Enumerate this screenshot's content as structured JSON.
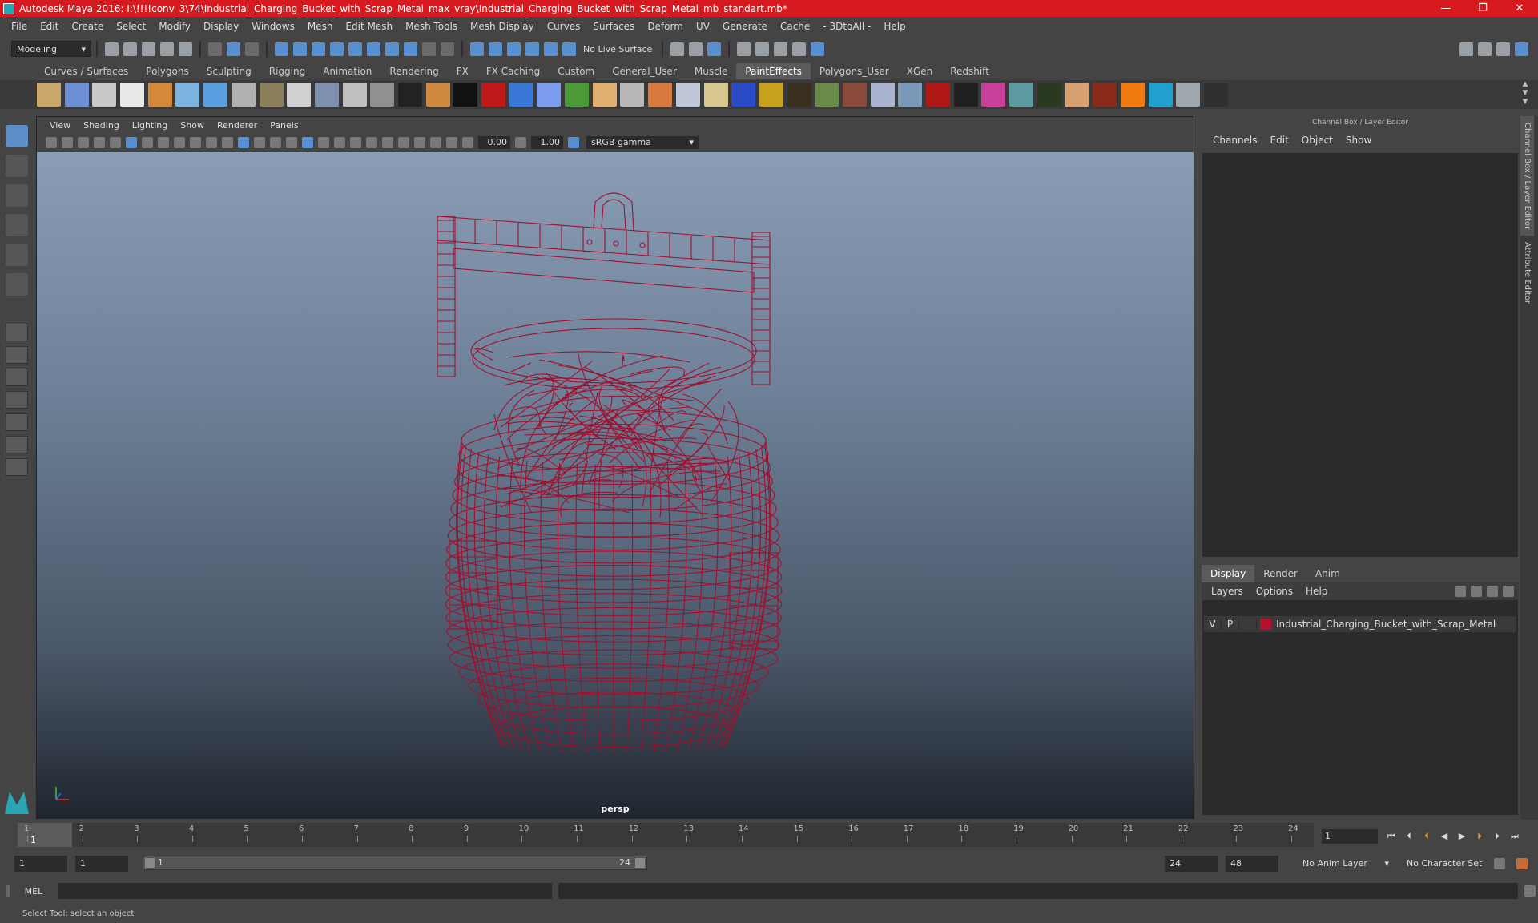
{
  "window": {
    "title": "Autodesk Maya 2016: I:\\!!!!conv_3\\74\\Industrial_Charging_Bucket_with_Scrap_Metal_max_vray\\Industrial_Charging_Bucket_with_Scrap_Metal_mb_standart.mb*",
    "minimize": "—",
    "restore": "❐",
    "close": "✕"
  },
  "menubar": [
    "File",
    "Edit",
    "Create",
    "Select",
    "Modify",
    "Display",
    "Windows",
    "Mesh",
    "Edit Mesh",
    "Mesh Tools",
    "Mesh Display",
    "Curves",
    "Surfaces",
    "Deform",
    "UV",
    "Generate",
    "Cache",
    "- 3DtoAll -",
    "Help"
  ],
  "statusline": {
    "mode": "Modeling",
    "live_surface": "No Live Surface"
  },
  "shelf_tabs": [
    "Curves / Surfaces",
    "Polygons",
    "Sculpting",
    "Rigging",
    "Animation",
    "Rendering",
    "FX",
    "FX Caching",
    "Custom",
    "General_User",
    "Muscle",
    "PaintEffects",
    "Polygons_User",
    "XGen",
    "Redshift"
  ],
  "active_shelf_tab": "PaintEffects",
  "shelf_icon_colors": [
    "#c9a86a",
    "#6d8fd6",
    "#c8c8c8",
    "#e8e8e8",
    "#d48a3a",
    "#7cb3e0",
    "#5aa0e0",
    "#b0b0b0",
    "#8a7f5a",
    "#d0d0d0",
    "#8090b0",
    "#c0c0c0",
    "#909090",
    "#222222",
    "#d08a40",
    "#111111",
    "#c01818",
    "#3a78d8",
    "#7c9cf0",
    "#4a9a3a",
    "#e0b070",
    "#b8b8b8",
    "#d87a40",
    "#c0c8d8",
    "#d8c890",
    "#2a4ac8",
    "#c8a020",
    "#3a3020",
    "#6a8a4a",
    "#8a4a3a",
    "#aab4d0",
    "#7a98b8",
    "#b01818",
    "#202020",
    "#c8409a",
    "#5a9aa0",
    "#2a3a20",
    "#d8a070",
    "#8a2a1a",
    "#f07a10",
    "#20a0d0",
    "#a0a8b0",
    "#303030"
  ],
  "viewport": {
    "menu": [
      "View",
      "Shading",
      "Lighting",
      "Show",
      "Renderer",
      "Panels"
    ],
    "exposure": "0.00",
    "gamma": "1.00",
    "color_space": "sRGB gamma",
    "camera": "persp",
    "wire_color": "#a0102e"
  },
  "channel_box": {
    "title": "Channel Box / Layer Editor",
    "menu": [
      "Channels",
      "Edit",
      "Object",
      "Show"
    ]
  },
  "layer_editor": {
    "tabs": [
      "Display",
      "Render",
      "Anim"
    ],
    "active_tab": "Display",
    "menu": [
      "Layers",
      "Options",
      "Help"
    ],
    "layers": [
      {
        "v": "V",
        "p": "P",
        "color": "#b3102e",
        "name": "Industrial_Charging_Bucket_with_Scrap_Metal"
      }
    ]
  },
  "side_tabs": [
    "Channel Box / Layer Editor",
    "Attribute Editor"
  ],
  "time_slider": {
    "ticks": [
      "1",
      "2",
      "3",
      "4",
      "5",
      "6",
      "7",
      "8",
      "9",
      "10",
      "11",
      "12",
      "13",
      "14",
      "15",
      "16",
      "17",
      "18",
      "19",
      "20",
      "21",
      "22",
      "23",
      "24"
    ],
    "current_frame": "1",
    "current_frame_field": "1"
  },
  "range_slider": {
    "start": "1",
    "playback_start": "1",
    "range_start_label": "1",
    "range_end_label": "24",
    "playback_end": "24",
    "end": "48",
    "anim_layer": "No Anim Layer",
    "character_set": "No Character Set"
  },
  "command_line": {
    "label": "MEL"
  },
  "help_line": "Select Tool: select an object"
}
